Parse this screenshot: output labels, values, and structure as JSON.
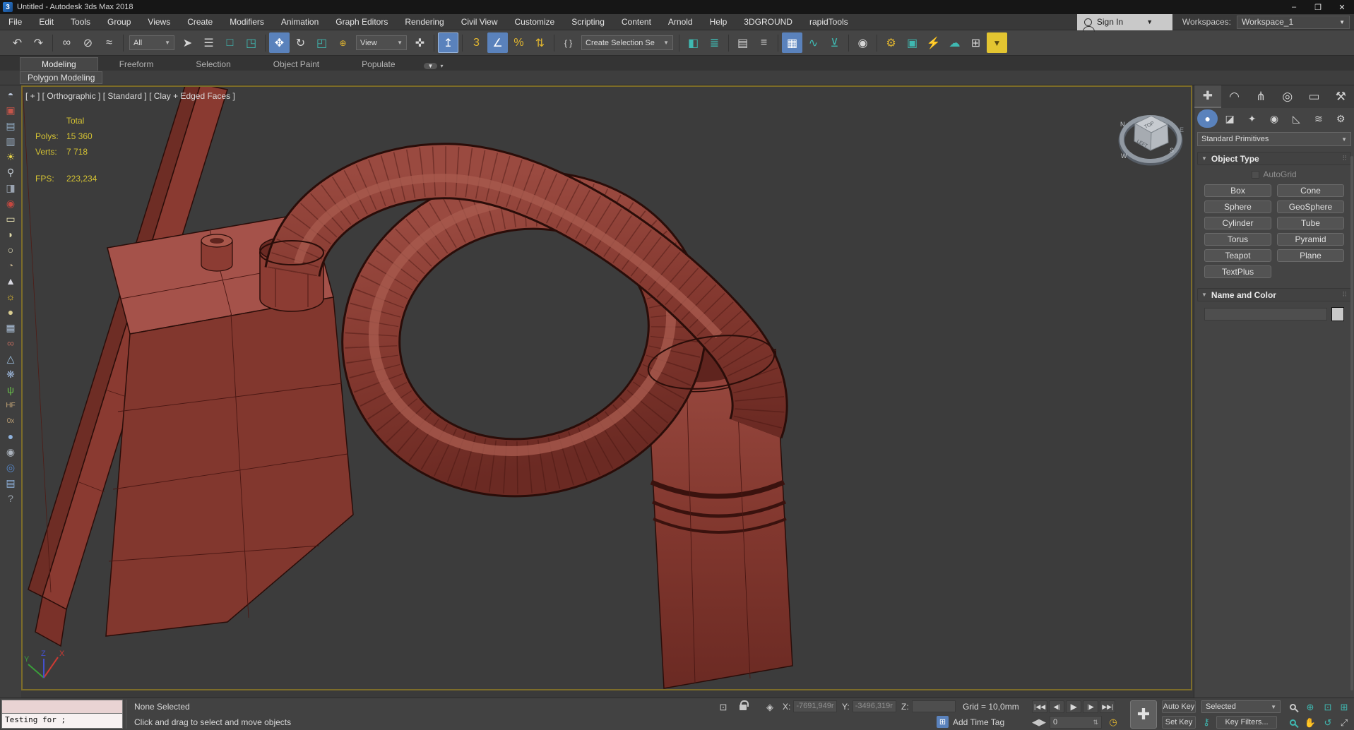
{
  "window": {
    "title": "Untitled - Autodesk 3ds Max 2018",
    "app_icon": "3",
    "minimize": "–",
    "maximize": "❐",
    "close": "✕"
  },
  "menubar": {
    "items": [
      {
        "label": "File"
      },
      {
        "label": "Edit"
      },
      {
        "label": "Tools"
      },
      {
        "label": "Group"
      },
      {
        "label": "Views"
      },
      {
        "label": "Create"
      },
      {
        "label": "Modifiers"
      },
      {
        "label": "Animation"
      },
      {
        "label": "Graph Editors"
      },
      {
        "label": "Rendering"
      },
      {
        "label": "Civil View"
      },
      {
        "label": "Customize"
      },
      {
        "label": "Scripting"
      },
      {
        "label": "Content"
      },
      {
        "label": "Arnold"
      },
      {
        "label": "Help"
      },
      {
        "label": "3DGROUND"
      },
      {
        "label": "rapidTools"
      }
    ],
    "sign_in": "Sign In",
    "workspaces_label": "Workspaces:",
    "workspace_value": "Workspace_1",
    "caret": "▼"
  },
  "toolbar": {
    "filter_value": "All",
    "ref_coord_value": "View",
    "selection_set_value": "Create Selection Se",
    "caret": "▼",
    "items": [
      {
        "g": "↶"
      },
      {
        "g": "↷"
      },
      {
        "g": "∞"
      },
      {
        "g": "⊘"
      },
      {
        "g": "≈"
      },
      {
        "g": "➤"
      },
      {
        "g": "☰"
      },
      {
        "g": "□"
      },
      {
        "g": "◳"
      },
      {
        "g": "✥"
      },
      {
        "g": "↻"
      },
      {
        "g": "◰"
      },
      {
        "g": "⊕"
      },
      {
        "g": "✜"
      },
      {
        "g": "↥"
      },
      {
        "g": "3"
      },
      {
        "g": "∠"
      },
      {
        "g": "%"
      },
      {
        "g": "⇅"
      },
      {
        "g": "{ }"
      },
      {
        "g": "◧"
      },
      {
        "g": "≣"
      },
      {
        "g": "▤"
      },
      {
        "g": "≡"
      },
      {
        "g": "▦"
      },
      {
        "g": "∿"
      },
      {
        "g": "⊻"
      },
      {
        "g": "◉"
      },
      {
        "g": "⚙"
      },
      {
        "g": "▣"
      },
      {
        "g": "⚡"
      },
      {
        "g": "☁"
      },
      {
        "g": "⊞"
      },
      {
        "g": "▼"
      }
    ]
  },
  "ribbon": {
    "tabs": [
      {
        "label": "Modeling"
      },
      {
        "label": "Freeform"
      },
      {
        "label": "Selection"
      },
      {
        "label": "Object Paint"
      },
      {
        "label": "Populate"
      }
    ],
    "cloud_caret": "▼",
    "caret": "▾",
    "panel_label": "Polygon Modeling"
  },
  "leftrail": {
    "items": [
      {
        "g": "◓",
        "style": "color:#b9c5d9"
      },
      {
        "g": "▣",
        "style": "color:#c4554a"
      },
      {
        "g": "▤",
        "style": "color:#8fa9c0"
      },
      {
        "g": "▥",
        "style": "color:#9fb3c8"
      },
      {
        "g": "☀",
        "style": "color:#e8d44a"
      },
      {
        "g": "⚲",
        "style": "color:#c5cdd5"
      },
      {
        "g": "◨",
        "style": "color:#9aa3b0"
      },
      {
        "g": "◉",
        "style": "color:#c44840"
      },
      {
        "g": "▭",
        "style": "color:#ece6b4"
      },
      {
        "g": "◗",
        "style": "color:#ded8a8"
      },
      {
        "g": "○",
        "style": "color:#efe9c1"
      },
      {
        "g": "◔",
        "style": "color:#b9a988"
      },
      {
        "g": "▲",
        "style": "color:#d9d9e1"
      },
      {
        "g": "☼",
        "style": "color:#f0c830"
      },
      {
        "g": "●",
        "style": "color:#d9cd91"
      },
      {
        "g": "▦",
        "style": "color:#a9bdd5"
      },
      {
        "g": "∞",
        "style": "color:#b0665a"
      },
      {
        "g": "△",
        "style": "color:#9ec1e1"
      },
      {
        "g": "❋",
        "style": "color:#9bb5d9"
      },
      {
        "g": "ψ",
        "style": "color:#6abf4a"
      },
      {
        "g": "HF",
        "style": "color:#c9a979;font-size:10px"
      },
      {
        "g": "0x",
        "style": "color:#b99d73;font-size:10px"
      },
      {
        "g": "●",
        "style": "color:#8fb2dd"
      },
      {
        "g": "◉",
        "style": "color:#aab2bc"
      },
      {
        "g": "◎",
        "style": "color:#5588cc"
      },
      {
        "g": "▤",
        "style": "color:#8fb2dd"
      },
      {
        "g": "?",
        "style": "color:#9aa2aa"
      }
    ]
  },
  "viewport": {
    "label": "[ + ] [ Orthographic ] [ Standard ] [ Clay + Edged Faces ]",
    "stats": {
      "total_label": "Total",
      "polys_label": "Polys:",
      "polys_value": "15 360",
      "verts_label": "Verts:",
      "verts_value": "7 718",
      "fps_label": "FPS:",
      "fps_value": "223,234"
    },
    "axis": {
      "x": "X",
      "y": "Y",
      "z": "Z"
    },
    "viewcube": {
      "top": "TOP",
      "left": "LEFT",
      "n": "N",
      "e": "E",
      "s": "S",
      "w": "W"
    }
  },
  "command_panel": {
    "tabs": [
      {
        "g": "✚"
      },
      {
        "g": "◠"
      },
      {
        "g": "⋔"
      },
      {
        "g": "◎"
      },
      {
        "g": "▭"
      },
      {
        "g": "⚒"
      }
    ],
    "categories": [
      {
        "g": "●"
      },
      {
        "g": "◪"
      },
      {
        "g": "✦"
      },
      {
        "g": "◉"
      },
      {
        "g": "◺"
      },
      {
        "g": "≋"
      },
      {
        "g": "⚙"
      }
    ],
    "dropdown_value": "Standard Primitives",
    "caret": "▼",
    "grip": "⠿",
    "arrow": "▼",
    "object_type": {
      "title": "Object Type",
      "autogrid_label": "AutoGrid",
      "buttons": [
        {
          "label": "Box"
        },
        {
          "label": "Cone"
        },
        {
          "label": "Sphere"
        },
        {
          "label": "GeoSphere"
        },
        {
          "label": "Cylinder"
        },
        {
          "label": "Tube"
        },
        {
          "label": "Torus"
        },
        {
          "label": "Pyramid"
        },
        {
          "label": "Teapot"
        },
        {
          "label": "Plane"
        },
        {
          "label": "TextPlus"
        }
      ]
    },
    "name_color": {
      "title": "Name and Color"
    }
  },
  "statusbar": {
    "listener_text": "Testing for ;",
    "selection_status": "None Selected",
    "prompt": "Click and drag to select and move objects",
    "isolate_glyph": "⊡",
    "abs_glyph": "◈",
    "x_label": "X:",
    "x_value": "-7691,949r",
    "y_label": "Y:",
    "y_value": "-3496,319r",
    "z_label": "Z:",
    "z_value": "",
    "grid_label": "Grid = 10,0mm",
    "cube_glyph": "⊞",
    "add_time_tag": "Add Time Tag",
    "go_start": "|◀◀",
    "prev_frame": "◀|",
    "play": "▶",
    "next_frame": "|▶",
    "go_end": "▶▶|",
    "frame_nav": "◀▶",
    "frame_value": "0",
    "spin": "⇅",
    "clock": "◷",
    "key_plus": "✚",
    "auto_key": "Auto Key",
    "set_key": "Set Key",
    "selected_value": "Selected",
    "caret": "▼",
    "key_filter_glyph": "⚷",
    "key_filters": "Key Filters...",
    "zoom_all_glyph": "⊕",
    "extents_glyph": "⊡",
    "extents_all_glyph": "⊞",
    "orbit_glyph": "↺",
    "pan_glyph": "✋",
    "max_toggle_glyph": "⤢"
  },
  "colors": {
    "accent_blue": "#5a82bc",
    "teal": "#3fb9b2",
    "viewport_border": "#7d6d2a",
    "stats_yellow": "#d4c233",
    "model_red": "#82372e"
  }
}
